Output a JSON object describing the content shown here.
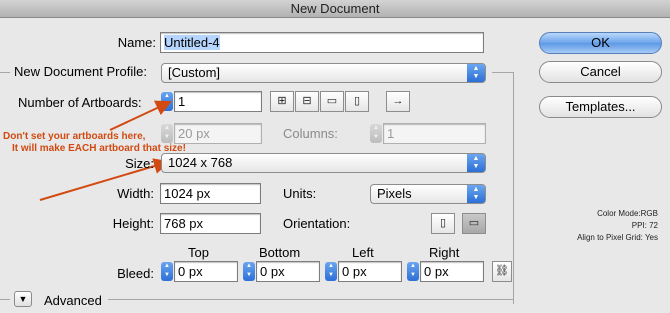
{
  "window": {
    "title": "New Document"
  },
  "name": {
    "label": "Name:",
    "value": "Untitled-4"
  },
  "profile": {
    "label": "New Document Profile:",
    "value": "[Custom]"
  },
  "artboards": {
    "label": "Number of Artboards:",
    "value": "1",
    "spacing_value": "20 px",
    "columns_label": "Columns:",
    "columns_value": "1",
    "layout_icons": [
      "grid-by-row-icon",
      "grid-by-column-icon",
      "arrange-by-row-icon",
      "arrange-by-column-icon"
    ],
    "direction_icon": "right-arrow-icon"
  },
  "annotation": {
    "line1": "Don't set your artboards here,",
    "line2": "It will make EACH artboard that size!",
    "color": "#d24a12"
  },
  "size": {
    "label": "Size:",
    "value": "1024 x 768"
  },
  "width": {
    "label": "Width:",
    "value": "1024 px"
  },
  "units": {
    "label": "Units:",
    "value": "Pixels"
  },
  "height": {
    "label": "Height:",
    "value": "768 px"
  },
  "orientation": {
    "label": "Orientation:",
    "icons": [
      "portrait-icon",
      "landscape-icon"
    ]
  },
  "bleed": {
    "label": "Bleed:",
    "headers": {
      "top": "Top",
      "bottom": "Bottom",
      "left": "Left",
      "right": "Right"
    },
    "values": {
      "top": "0 px",
      "bottom": "0 px",
      "left": "0 px",
      "right": "0 px"
    },
    "link_icon": "chain-link-icon"
  },
  "advanced": {
    "label": "Advanced"
  },
  "buttons": {
    "ok": "OK",
    "cancel": "Cancel",
    "templates": "Templates..."
  },
  "info": {
    "color_mode": "Color Mode:RGB",
    "ppi": "PPI: 72",
    "align": "Align to Pixel Grid: Yes"
  },
  "colors": {
    "accent": "#3a7ee0",
    "annotation": "#d24a12"
  }
}
